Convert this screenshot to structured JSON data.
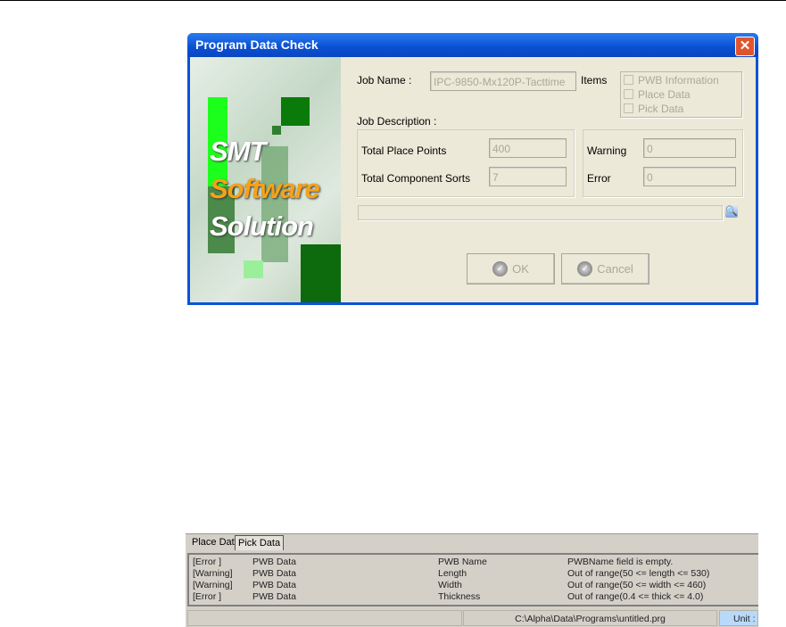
{
  "dialog": {
    "title": "Program Data Check",
    "logo_lines": [
      "SMT",
      "Software",
      "Solution"
    ],
    "job_name_label": "Job Name :",
    "job_name_value": "IPC-9850-Mx120P-Tacttime",
    "items_label": "Items",
    "items": [
      "PWB Information",
      "Place Data",
      "Pick Data"
    ],
    "job_description_label": "Job Description :",
    "total_place_points_label": "Total Place Points",
    "total_place_points_value": "400",
    "total_component_sorts_label": "Total Component Sorts",
    "total_component_sorts_value": "7",
    "warning_label": "Warning",
    "warning_value": "0",
    "error_label": "Error",
    "error_value": "0",
    "progress": 0,
    "ok_label": "OK",
    "cancel_label": "Cancel"
  },
  "bottom": {
    "tabs": [
      "Place Data",
      "Pick Data"
    ],
    "rows": [
      [
        "[Error  ]",
        "PWB Data",
        "PWB Name",
        "PWBName field is empty."
      ],
      [
        "[Warning]",
        "PWB Data",
        "Length",
        "Out of range(50 <= length <= 530)"
      ],
      [
        "[Warning]",
        "PWB Data",
        "Width",
        "Out of range(50 <= width <= 460)"
      ],
      [
        "[Error  ]",
        "PWB Data",
        "Thickness",
        "Out of range(0.4 <= thick <= 4.0)"
      ]
    ],
    "status_path": "C:\\Alpha\\Data\\Programs\\untitled.prg",
    "status_unit": "Unit :"
  }
}
